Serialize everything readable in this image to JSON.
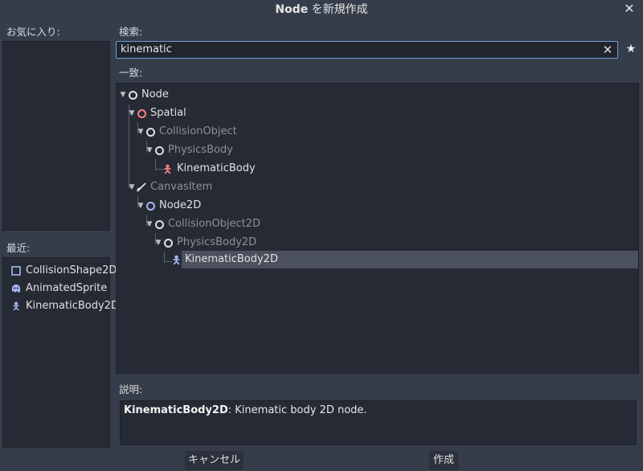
{
  "dialog": {
    "title_strong": "Node",
    "title_rest": " を新規作成",
    "close_icon": "close-icon"
  },
  "favorites": {
    "label": "お気に入り:"
  },
  "recent": {
    "label": "最近:",
    "items": [
      {
        "label": "CollisionShape2D",
        "icon": "collision-shape-2d-icon",
        "color": "#a5b7f3"
      },
      {
        "label": "AnimatedSprite",
        "icon": "animated-sprite-icon",
        "color": "#a5b7f3"
      },
      {
        "label": "KinematicBody2D",
        "icon": "kinematic-body-2d-icon",
        "color": "#a5b7f3"
      }
    ]
  },
  "search": {
    "label": "検索:",
    "value": "kinematic",
    "favorite_icon": "star-icon",
    "clear_icon": "clear-icon"
  },
  "matches": {
    "label": "一致:",
    "tree": [
      {
        "label": "Node",
        "icon": "node-icon",
        "dim": false
      },
      {
        "label": "Spatial",
        "icon": "spatial-icon",
        "dim": false
      },
      {
        "label": "CollisionObject",
        "icon": "node-icon",
        "dim": true
      },
      {
        "label": "PhysicsBody",
        "icon": "node-icon",
        "dim": true
      },
      {
        "label": "KinematicBody",
        "icon": "kinematic-body-icon",
        "dim": false
      },
      {
        "label": "CanvasItem",
        "icon": "canvas-item-icon",
        "dim": true
      },
      {
        "label": "Node2D",
        "icon": "node2d-icon",
        "dim": false
      },
      {
        "label": "CollisionObject2D",
        "icon": "node-icon",
        "dim": true
      },
      {
        "label": "PhysicsBody2D",
        "icon": "node-icon",
        "dim": true
      },
      {
        "label": "KinematicBody2D",
        "icon": "kinematic-body-2d-icon",
        "dim": false,
        "selected": true
      }
    ]
  },
  "description": {
    "label": "説明:",
    "name": "KinematicBody2D",
    "text": ": Kinematic body 2D node."
  },
  "buttons": {
    "cancel": "キャンセル",
    "create": "作成"
  },
  "colors": {
    "accent": "#6f9ed8",
    "node_3d": "#fc7f7f",
    "node_2d": "#a5b7f3",
    "background": "#363d4a",
    "panel": "#252a34"
  }
}
